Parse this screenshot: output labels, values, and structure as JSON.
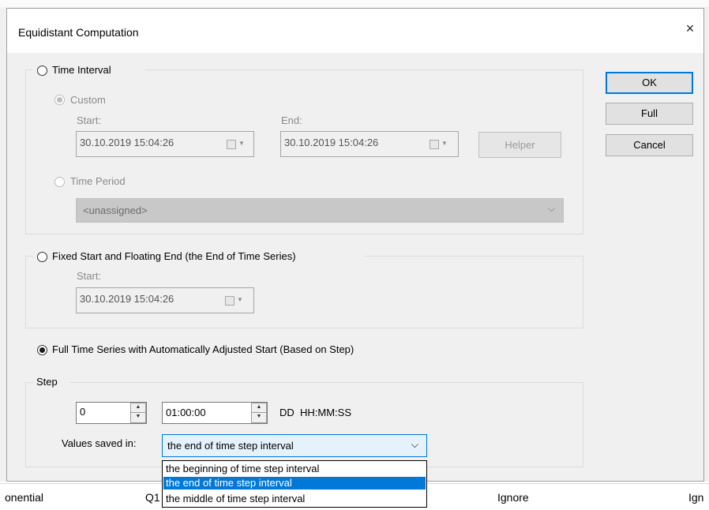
{
  "window": {
    "title": "Equidistant Computation",
    "close_icon": "×"
  },
  "buttons": {
    "ok": "OK",
    "full": "Full",
    "cancel": "Cancel",
    "helper": "Helper"
  },
  "time_interval": {
    "label": "Time Interval",
    "custom_label": "Custom",
    "start_label": "Start:",
    "end_label": "End:",
    "start_value": "30.10.2019 15:04:26",
    "end_value": "30.10.2019 15:04:26",
    "time_period_label": "Time Period",
    "time_period_value": "<unassigned>"
  },
  "fixed_start": {
    "label": "Fixed Start and Floating End (the End of Time Series)",
    "start_label": "Start:",
    "start_value": "30.10.2019 15:04:26"
  },
  "full_series": {
    "label": "Full Time Series with Automatically Adjusted Start (Based on Step)"
  },
  "step": {
    "label": "Step",
    "days_value": "0",
    "time_value": "01:00:00",
    "format_label": "DD  HH:MM:SS",
    "values_saved_label": "Values saved in:",
    "values_saved_selected": "the end of time step interval",
    "options": [
      "the beginning of time step interval",
      "the end of time step interval",
      "the middle of time step interval"
    ]
  },
  "background_row": {
    "col1": "onential",
    "col2": "Q1",
    "col3": "Ignore",
    "col4": "Ign"
  }
}
